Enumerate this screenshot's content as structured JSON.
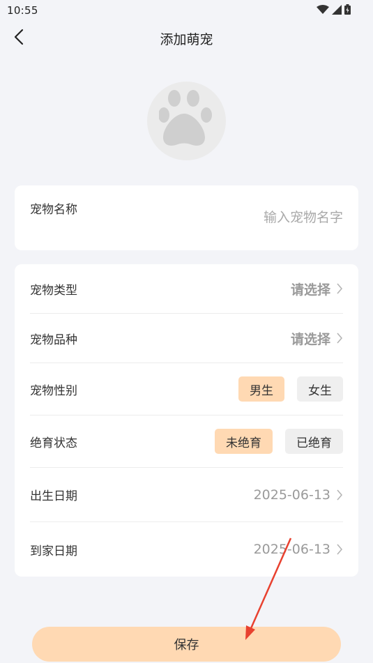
{
  "status_bar": {
    "time": "10:55"
  },
  "header": {
    "title": "添加萌宠"
  },
  "name_field": {
    "label": "宠物名称",
    "placeholder": "输入宠物名字",
    "value": ""
  },
  "form": {
    "type": {
      "label": "宠物类型",
      "value": "请选择"
    },
    "breed": {
      "label": "宠物品种",
      "value": "请选择"
    },
    "gender": {
      "label": "宠物性别",
      "options": [
        "男生",
        "女生"
      ],
      "selected": "男生"
    },
    "neuter": {
      "label": "绝育状态",
      "options": [
        "未绝育",
        "已绝育"
      ],
      "selected": "未绝育"
    },
    "birth_date": {
      "label": "出生日期",
      "value": "2025-06-13"
    },
    "arrival_date": {
      "label": "到家日期",
      "value": "2025-06-13"
    }
  },
  "save_label": "保存",
  "colors": {
    "accent": "#ffd9b3",
    "background": "#f3f4f8",
    "annotation_arrow": "#e8412f"
  }
}
